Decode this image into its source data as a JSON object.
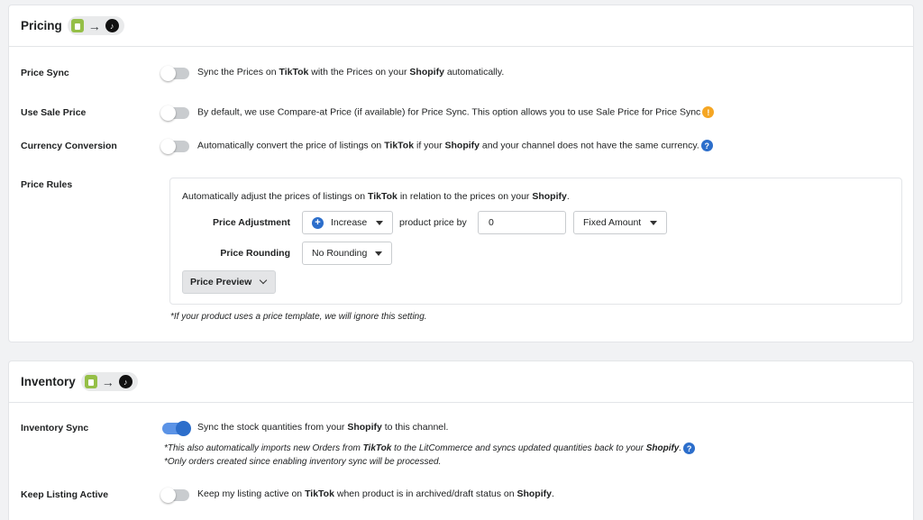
{
  "pricing": {
    "title": "Pricing",
    "price_sync": {
      "label": "Price Sync",
      "enabled": false,
      "desc_1": "Sync the Prices on ",
      "desc_tiktok": "TikTok",
      "desc_2": " with the Prices on your ",
      "desc_shopify": "Shopify",
      "desc_3": " automatically."
    },
    "use_sale_price": {
      "label": "Use Sale Price",
      "enabled": false,
      "desc": "By default, we use Compare-at Price (if available) for Price Sync. This option allows you to use Sale Price for Price Sync",
      "info_icon": "!"
    },
    "currency_conversion": {
      "label": "Currency Conversion",
      "enabled": false,
      "desc_1": "Automatically convert the price of listings on ",
      "desc_tiktok": "TikTok",
      "desc_2": " if your ",
      "desc_shopify": "Shopify",
      "desc_3": " and your channel does not have the same currency.",
      "info_icon": "?"
    },
    "price_rules": {
      "label": "Price Rules",
      "intro_1": "Automatically adjust the prices of listings on ",
      "intro_tiktok": "TikTok",
      "intro_2": " in relation to the prices on your ",
      "intro_shopify": "Shopify",
      "intro_3": ".",
      "adjustment_label": "Price Adjustment",
      "adjustment_direction": "Increase",
      "product_price_by": "product price by",
      "amount_value": "0",
      "amount_type": "Fixed Amount",
      "rounding_label": "Price Rounding",
      "rounding_value": "No Rounding",
      "preview_button": "Price Preview",
      "template_note": "*If your product uses a price template, we will ignore this setting."
    }
  },
  "inventory": {
    "title": "Inventory",
    "inventory_sync": {
      "label": "Inventory Sync",
      "enabled": true,
      "desc_1": "Sync the stock quantities from your ",
      "desc_shopify": "Shopify",
      "desc_2": " to this channel.",
      "note1_1": "*This also automatically imports new Orders from ",
      "note1_tiktok": "TikTok",
      "note1_2": " to the LitCommerce and syncs updated quantities back to your ",
      "note1_shopify": "Shopify",
      "note1_3": ".",
      "note1_icon": "?",
      "note2": "*Only orders created since enabling inventory sync will be processed."
    },
    "keep_listing_active": {
      "label": "Keep Listing Active",
      "enabled": false,
      "desc_1": "Keep my listing active on ",
      "desc_tiktok": "TikTok",
      "desc_2": " when product is in archived/draft status on ",
      "desc_shopify": "Shopify",
      "desc_3": "."
    }
  },
  "icons": {
    "shopify": "shopify-icon",
    "arrow": "→",
    "tiktok": "♪",
    "plus": "+"
  },
  "colors": {
    "accent": "#2c6ecb",
    "toggle_on": "#5b93e6",
    "warning": "#f5a623",
    "shopify_green": "#95bf47"
  }
}
